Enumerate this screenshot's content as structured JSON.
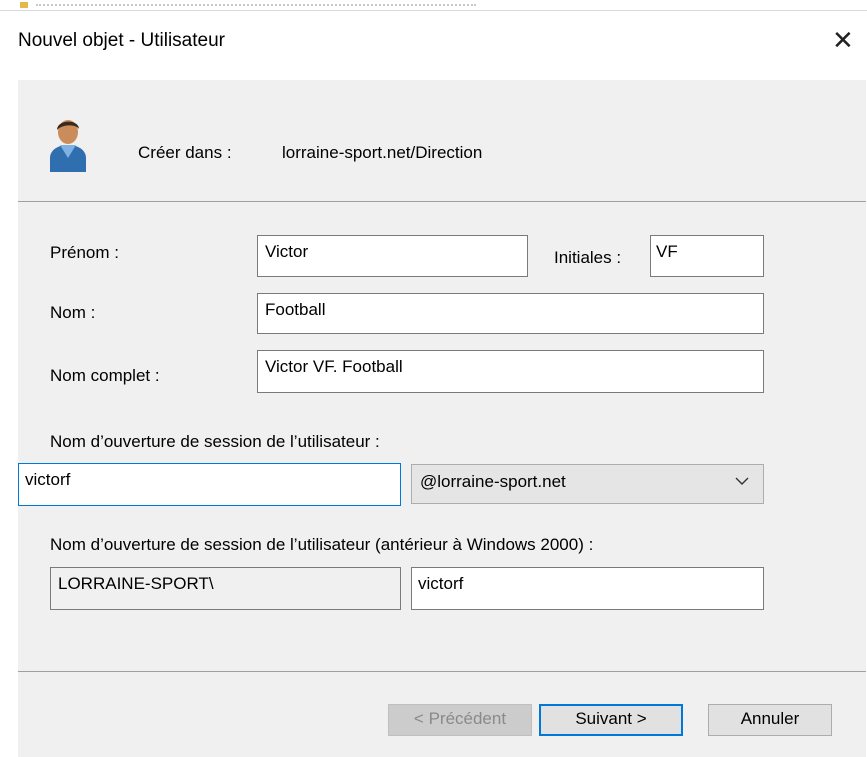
{
  "dialog": {
    "title": "Nouvel objet - Utilisateur",
    "close_symbol": "✕"
  },
  "header": {
    "icon": "user-icon",
    "create_in_label": "Créer dans :",
    "create_in_path": "lorraine-sport.net/Direction"
  },
  "form": {
    "first_name_label": "Prénom :",
    "first_name_value": "Victor",
    "initials_label": "Initiales :",
    "initials_value": "VF",
    "last_name_label": "Nom :",
    "last_name_value": "Football",
    "full_name_label": "Nom complet :",
    "full_name_value": "Victor VF. Football",
    "logon_label": "Nom d’ouverture de session de l’utilisateur :",
    "logon_value": "victorf",
    "domain_value": "@lorraine-sport.net",
    "pre2000_label": "Nom d’ouverture de session de l’utilisateur (antérieur à Windows 2000) :",
    "pre2000_domain": "LORRAINE-SPORT\\",
    "pre2000_value": "victorf"
  },
  "buttons": {
    "previous": "< Précédent",
    "next": "Suivant >",
    "cancel": "Annuler"
  },
  "colors": {
    "panel": "#f0f0f0",
    "accent": "#0078d7"
  }
}
